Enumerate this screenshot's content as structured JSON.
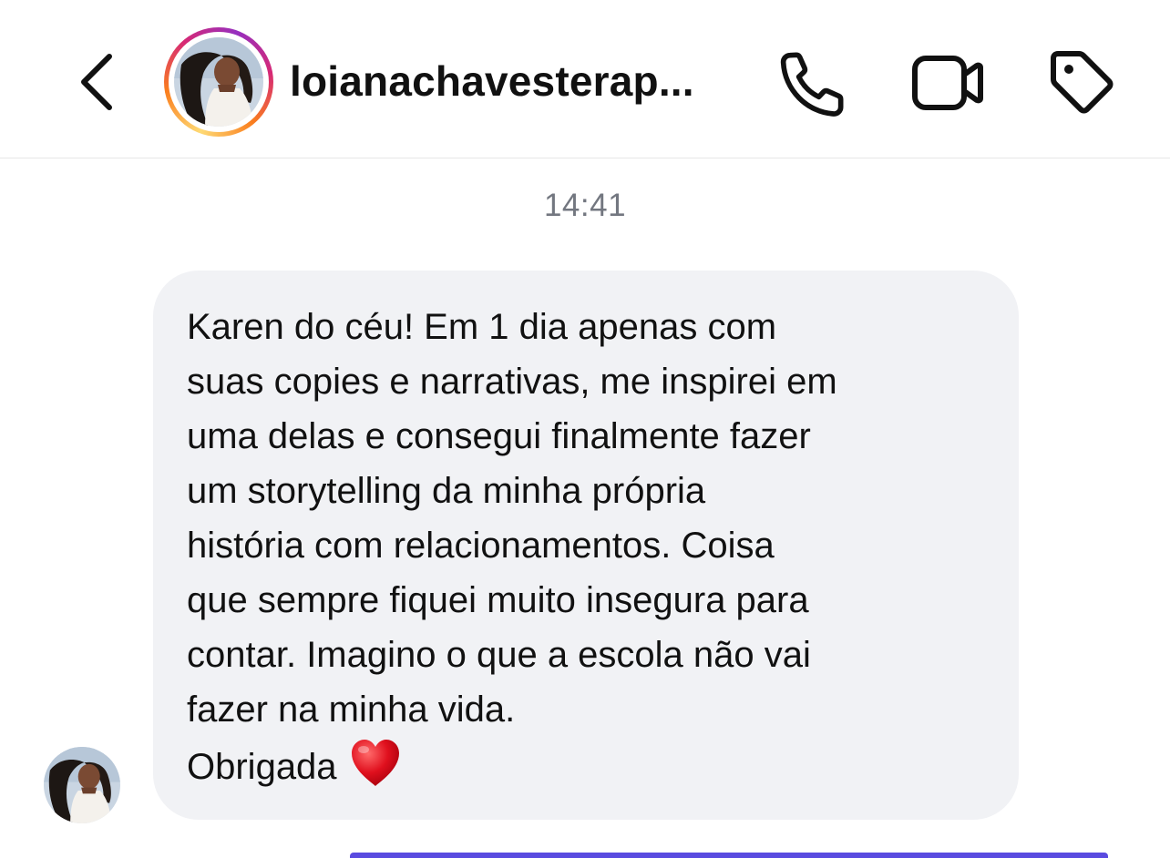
{
  "header": {
    "back_icon": "chevron-left-icon",
    "username": "loianachavesterap...",
    "avatar_alt": "profile-photo",
    "story_ring_colors": [
      "#feda75",
      "#fa7e1e",
      "#d62976",
      "#962fbf"
    ],
    "actions": [
      "phone-icon",
      "video-camera-icon",
      "tag-icon"
    ]
  },
  "thread": {
    "timestamp": "14:41",
    "message": {
      "lines": [
        "Karen do céu! Em 1 dia apenas com",
        "suas copies e narrativas, me inspirei em",
        "uma delas e consegui finalmente fazer",
        "um storytelling da minha própria",
        "história com relacionamentos. Coisa",
        "que sempre fiquei muito insegura para",
        "contar. Imagino o que a escola não vai",
        "fazer na minha vida.",
        "Obrigada"
      ],
      "emoji": "heart-emoji",
      "bubble_color": "#f1f2f5"
    }
  },
  "colors": {
    "text": "#111111",
    "timestamp": "#737780",
    "heart": "#e0101e",
    "next_bubble": "#5a4be0"
  }
}
